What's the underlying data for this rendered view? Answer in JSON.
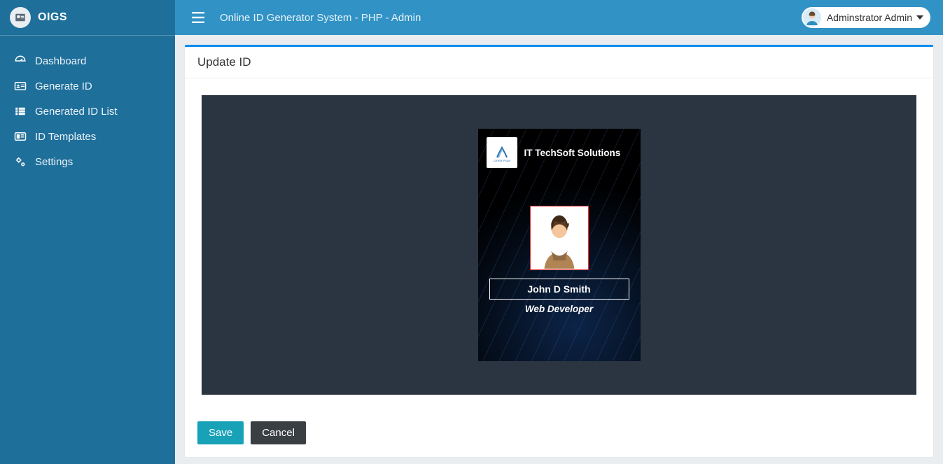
{
  "brand": {
    "name": "OIGS"
  },
  "sidebar": {
    "items": [
      {
        "label": "Dashboard",
        "icon": "gauge-icon"
      },
      {
        "label": "Generate ID",
        "icon": "id-card-icon"
      },
      {
        "label": "Generated ID List",
        "icon": "list-icon"
      },
      {
        "label": "ID Templates",
        "icon": "template-icon"
      },
      {
        "label": "Settings",
        "icon": "gears-icon"
      }
    ]
  },
  "header": {
    "title": "Online ID Generator System - PHP - Admin",
    "user_name": "Adminstrator Admin"
  },
  "page": {
    "title": "Update ID",
    "id_card": {
      "company_name": "IT TechSoft Solutions",
      "person_name": "John D Smith",
      "person_role": "Web Developer"
    },
    "buttons": {
      "save": "Save",
      "cancel": "Cancel"
    }
  },
  "colors": {
    "sidebar_bg": "#1f6f9b",
    "topbar_bg": "#3192c5",
    "card_accent": "#0d8cf0",
    "save_btn": "#18a2b8",
    "cancel_btn": "#3a3f44",
    "id_stage_bg": "#2b3441"
  }
}
